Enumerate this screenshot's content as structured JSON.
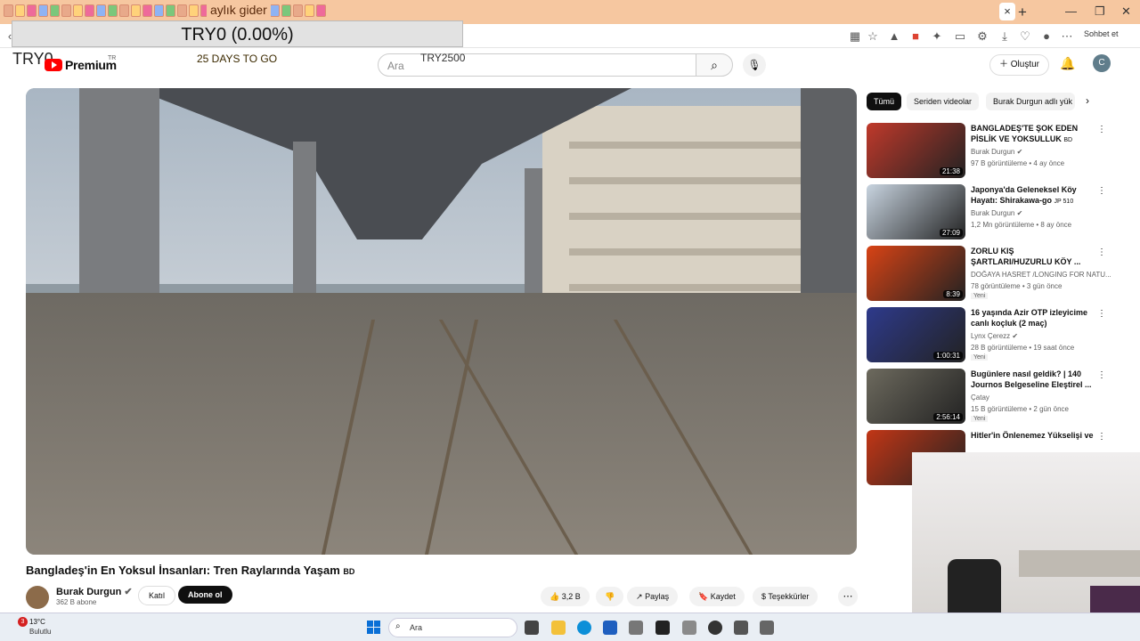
{
  "browser": {
    "tab_title": "aylık gider",
    "active_tab_close": "×",
    "new_tab": "+",
    "chat_label": "Sohbet et"
  },
  "overlay": {
    "box_text": "TRY0 (0.00%)",
    "try_top": "TRY0",
    "days_left": "25 DAYS TO GO",
    "try_search": "TRY2500"
  },
  "youtube": {
    "logo_text": "Premium",
    "region": "TR",
    "search_placeholder": "Ara",
    "create_label": "Oluştur",
    "avatar_letter": "C"
  },
  "video": {
    "title": "Bangladeş'in En Yoksul İnsanları: Tren Raylarında Yaşam",
    "title_flag": "BD",
    "channel": "Burak Durgun",
    "subscribers": "362 B abone",
    "join_label": "Katıl",
    "subscribe_label": "Abone ol",
    "likes": "3,2 B",
    "share_label": "Paylaş",
    "save_label": "Kaydet",
    "thanks_label": "Teşekkürler"
  },
  "chips": [
    {
      "label": "Tümü",
      "active": true
    },
    {
      "label": "Seriden videolar",
      "active": false
    },
    {
      "label": "Burak Durgun adlı yük",
      "active": false
    }
  ],
  "recommendations": [
    {
      "title": "BANGLADEŞ'TE ŞOK EDEN PİSLİK VE YOKSULLUK",
      "flag": "BD",
      "channel": "Burak Durgun",
      "verified": true,
      "meta": "97 B görüntüleme • 4 ay önce",
      "duration": "21:38",
      "new": ""
    },
    {
      "title": "Japonya'da Geleneksel Köy Hayatı: Shirakawa-go",
      "flag": "JP 510",
      "channel": "Burak Durgun",
      "verified": true,
      "meta": "1,2 Mn görüntüleme • 8 ay önce",
      "duration": "27:09",
      "new": ""
    },
    {
      "title": "ZORLU KIŞ ŞARTLARI/HUZURLU KÖY ...",
      "flag": "",
      "channel": "DOĞAYA HASRET /LONGING FOR NATU...",
      "verified": false,
      "meta": "78 görüntüleme • 3 gün önce",
      "duration": "8:39",
      "new": "Yeni"
    },
    {
      "title": "16 yaşında Azir OTP izleyicime canlı koçluk (2 maç)",
      "flag": "",
      "channel": "Lynx Çerezz",
      "verified": true,
      "meta": "28 B görüntüleme • 19 saat önce",
      "duration": "1:00:31",
      "new": "Yeni"
    },
    {
      "title": "Bugünlere nasıl geldik? | 140 Journos Belgeseline Eleştirel ...",
      "flag": "",
      "channel": "Çatay",
      "verified": false,
      "meta": "15 B görüntüleme • 2 gün önce",
      "duration": "2:56:14",
      "new": "Yeni"
    },
    {
      "title": "Hitler'in Önlenemez Yükselişi ve",
      "flag": "",
      "channel": "",
      "verified": false,
      "meta": "",
      "duration": "",
      "new": ""
    }
  ],
  "taskbar": {
    "badge": "3",
    "temperature": "13°C",
    "weather": "Bulutlu",
    "search_placeholder": "Ara"
  }
}
